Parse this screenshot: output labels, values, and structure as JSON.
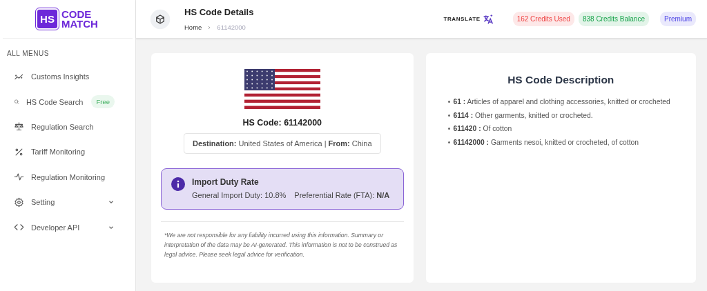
{
  "logo": {
    "mark": "HS",
    "lines": [
      "CODE",
      "MATCH"
    ]
  },
  "sidebar": {
    "heading": "ALL MENUS",
    "items": [
      {
        "label": "Customs Insights",
        "expandable": false
      },
      {
        "label": "HS Code Search",
        "badge": "Free",
        "expandable": false
      },
      {
        "label": "Regulation Search",
        "expandable": false
      },
      {
        "label": "Tariff Monitoring",
        "expandable": false
      },
      {
        "label": "Regulation Monitoring",
        "expandable": false
      },
      {
        "label": "Setting",
        "expandable": true
      },
      {
        "label": "Developer API",
        "expandable": true
      }
    ]
  },
  "header": {
    "title": "HS Code Details",
    "breadcrumb": [
      "Home",
      "61142000"
    ],
    "translate": "TRANSLATE",
    "pills": [
      {
        "label": "162 Credits Used",
        "color": "#ef4444"
      },
      {
        "label": "838 Credits Balance",
        "color": "#16a34a"
      },
      {
        "label": "Premium",
        "color": "#4f46e5"
      }
    ]
  },
  "details": {
    "hs_code": "HS Code: 61142000",
    "route": "**Destination:** United States of America | **From:** China",
    "duty": {
      "title": "Import Duty Rate",
      "general": "General Import Duty: 10.8%",
      "preferential": "Preferential Rate (FTA): **N/A**"
    },
    "disclaimer": "*We are not responsible for any liability incurred using this information. Summary or interpretation of the data may be AI-generated. This information is not to be construed as legal advice. Please seek legal advice for verification."
  },
  "description": {
    "title": "HS Code Description",
    "items": [
      "**61 :** Articles of apparel and clothing accessories, knitted or crocheted",
      "**6114 :** Other garments, knitted or crocheted.",
      "**611420 :** Of cotton",
      "**61142000 :** Garments nesoi, knitted or crocheted, of cotton"
    ]
  }
}
